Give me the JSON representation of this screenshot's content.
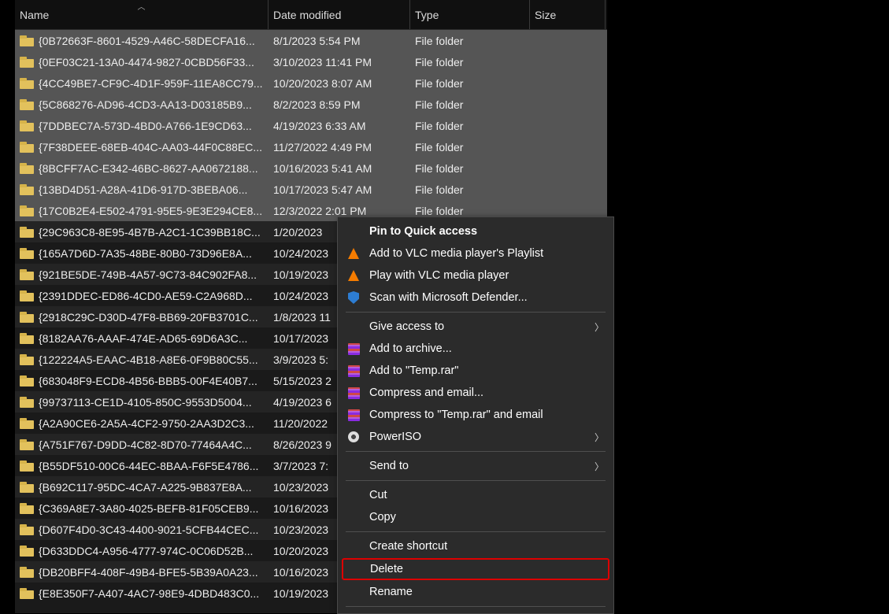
{
  "columns": {
    "name": "Name",
    "date": "Date modified",
    "type": "Type",
    "size": "Size"
  },
  "rows": [
    {
      "name": "{0B72663F-8601-4529-A46C-58DECFA16...",
      "date": "8/1/2023 5:54 PM",
      "type": "File folder",
      "sel": true
    },
    {
      "name": "{0EF03C21-13A0-4474-9827-0CBD56F33...",
      "date": "3/10/2023 11:41 PM",
      "type": "File folder",
      "sel": true
    },
    {
      "name": "{4CC49BE7-CF9C-4D1F-959F-11EA8CC79...",
      "date": "10/20/2023 8:07 AM",
      "type": "File folder",
      "sel": true
    },
    {
      "name": "{5C868276-AD96-4CD3-AA13-D03185B9...",
      "date": "8/2/2023 8:59 PM",
      "type": "File folder",
      "sel": true
    },
    {
      "name": "{7DDBEC7A-573D-4BD0-A766-1E9CD63...",
      "date": "4/19/2023 6:33 AM",
      "type": "File folder",
      "sel": true
    },
    {
      "name": "{7F38DEEE-68EB-404C-AA03-44F0C88EC...",
      "date": "11/27/2022 4:49 PM",
      "type": "File folder",
      "sel": true
    },
    {
      "name": "{8BCFF7AC-E342-46BC-8627-AA0672188...",
      "date": "10/16/2023 5:41 AM",
      "type": "File folder",
      "sel": true
    },
    {
      "name": "{13BD4D51-A28A-41D6-917D-3BEBA06...",
      "date": "10/17/2023 5:47 AM",
      "type": "File folder",
      "sel": true
    },
    {
      "name": "{17C0B2E4-E502-4791-95E5-9E3E294CE8...",
      "date": "12/3/2022 2:01 PM",
      "type": "File folder",
      "sel": true
    },
    {
      "name": "{29C963C8-8E95-4B7B-A2C1-1C39BB18C...",
      "date": "1/20/2023 ",
      "type": "",
      "sel": false
    },
    {
      "name": "{165A7D6D-7A35-48BE-80B0-73D96E8A...",
      "date": "10/24/2023",
      "type": "",
      "sel": false
    },
    {
      "name": "{921BE5DE-749B-4A57-9C73-84C902FA8...",
      "date": "10/19/2023",
      "type": "",
      "sel": false
    },
    {
      "name": "{2391DDEC-ED86-4CD0-AE59-C2A968D...",
      "date": "10/24/2023",
      "type": "",
      "sel": false
    },
    {
      "name": "{2918C29C-D30D-47F8-BB69-20FB3701C...",
      "date": "1/8/2023 11",
      "type": "",
      "sel": false
    },
    {
      "name": "{8182AA76-AAAF-474E-AD65-69D6A3C...",
      "date": "10/17/2023",
      "type": "",
      "sel": false
    },
    {
      "name": "{122224A5-EAAC-4B18-A8E6-0F9B80C55...",
      "date": "3/9/2023 5:",
      "type": "",
      "sel": false
    },
    {
      "name": "{683048F9-ECD8-4B56-BBB5-00F4E40B7...",
      "date": "5/15/2023 2",
      "type": "",
      "sel": false
    },
    {
      "name": "{99737113-CE1D-4105-850C-9553D5004...",
      "date": "4/19/2023 6",
      "type": "",
      "sel": false
    },
    {
      "name": "{A2A90CE6-2A5A-4CF2-9750-2AA3D2C3...",
      "date": "11/20/2022",
      "type": "",
      "sel": false
    },
    {
      "name": "{A751F767-D9DD-4C82-8D70-77464A4C...",
      "date": "8/26/2023 9",
      "type": "",
      "sel": false
    },
    {
      "name": "{B55DF510-00C6-44EC-8BAA-F6F5E4786...",
      "date": "3/7/2023 7:",
      "type": "",
      "sel": false
    },
    {
      "name": "{B692C117-95DC-4CA7-A225-9B837E8A...",
      "date": "10/23/2023",
      "type": "",
      "sel": false
    },
    {
      "name": "{C369A8E7-3A80-4025-BEFB-81F05CEB9...",
      "date": "10/16/2023",
      "type": "",
      "sel": false
    },
    {
      "name": "{D607F4D0-3C43-4400-9021-5CFB44CEC...",
      "date": "10/23/2023",
      "type": "",
      "sel": false
    },
    {
      "name": "{D633DDC4-A956-4777-974C-0C06D52B...",
      "date": "10/20/2023",
      "type": "",
      "sel": false
    },
    {
      "name": "{DB20BFF4-408F-49B4-BFE5-5B39A0A23...",
      "date": "10/16/2023",
      "type": "",
      "sel": false
    },
    {
      "name": "{E8E350F7-A407-4AC7-98E9-4DBD483C0...",
      "date": "10/19/2023",
      "type": "",
      "sel": false
    }
  ],
  "context_menu": {
    "pin": "Pin to Quick access",
    "vlc_playlist": "Add to VLC media player's Playlist",
    "vlc_play": "Play with VLC media player",
    "defender": "Scan with Microsoft Defender...",
    "give_access": "Give access to",
    "add_archive": "Add to archive...",
    "add_temp": "Add to \"Temp.rar\"",
    "compress_email": "Compress and email...",
    "compress_temp_email": "Compress to \"Temp.rar\" and email",
    "poweriso": "PowerISO",
    "send_to": "Send to",
    "cut": "Cut",
    "copy": "Copy",
    "shortcut": "Create shortcut",
    "delete": "Delete",
    "rename": "Rename"
  }
}
